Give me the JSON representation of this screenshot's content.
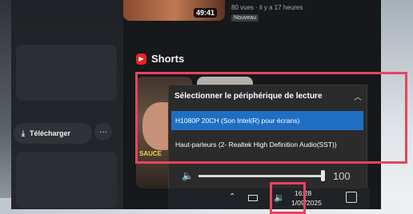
{
  "video": {
    "duration": "49:41",
    "meta": "80 vues · il y a 17 heures",
    "badge": "Nouveau"
  },
  "shorts": {
    "title": "Shorts",
    "card_text": "SAUCE"
  },
  "actions": {
    "download_label": "Télécharger",
    "more_label": "···"
  },
  "audio_flyout": {
    "title": "Sélectionner le périphérique de lecture",
    "devices": [
      {
        "label": "H1080P 20CH (Son Intel(R) pour écrans)",
        "selected": true
      },
      {
        "label": "Haut-parleurs (2- Realtek High Definition Audio(SST))",
        "selected": false
      }
    ],
    "volume": 100
  },
  "taskbar": {
    "time": "16:28",
    "date": "1/09/2025"
  },
  "colors": {
    "accent": "#1e6fc4",
    "highlight": "#e8445e"
  }
}
